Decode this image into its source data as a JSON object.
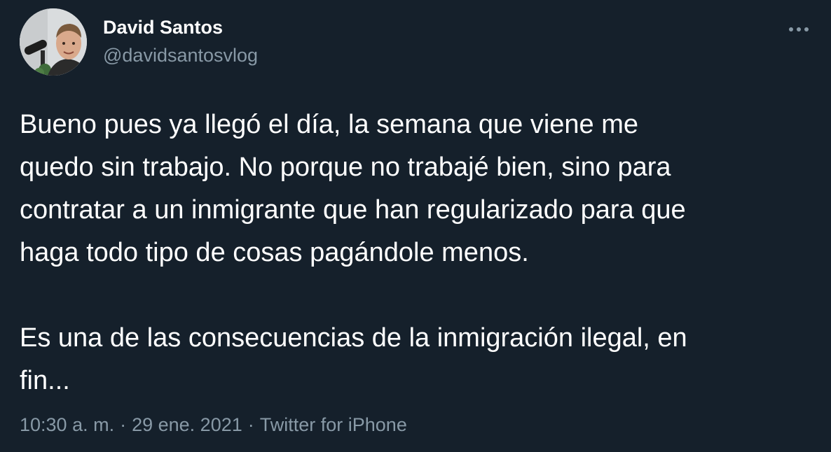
{
  "author": {
    "display_name": "David Santos",
    "handle": "@davidsantosvlog"
  },
  "more_icon": "more-horizontal-icon",
  "tweet": {
    "paragraph1_lines": [
      "Bueno pues ya llegó el día, la semana que viene me",
      "quedo sin trabajo. No porque no trabajé bien, sino para",
      "contratar a un inmigrante que han regularizado para que",
      "haga todo tipo de cosas pagándole menos."
    ],
    "paragraph2_lines": [
      "Es una de las consecuencias de la inmigración ilegal, en",
      "fin..."
    ]
  },
  "meta": {
    "time": "10:30 a. m.",
    "separator": "·",
    "date": "29 ene. 2021",
    "source": "Twitter for iPhone"
  },
  "colors": {
    "background": "#15202b",
    "text": "#ffffff",
    "secondary_text": "#8899a6"
  }
}
